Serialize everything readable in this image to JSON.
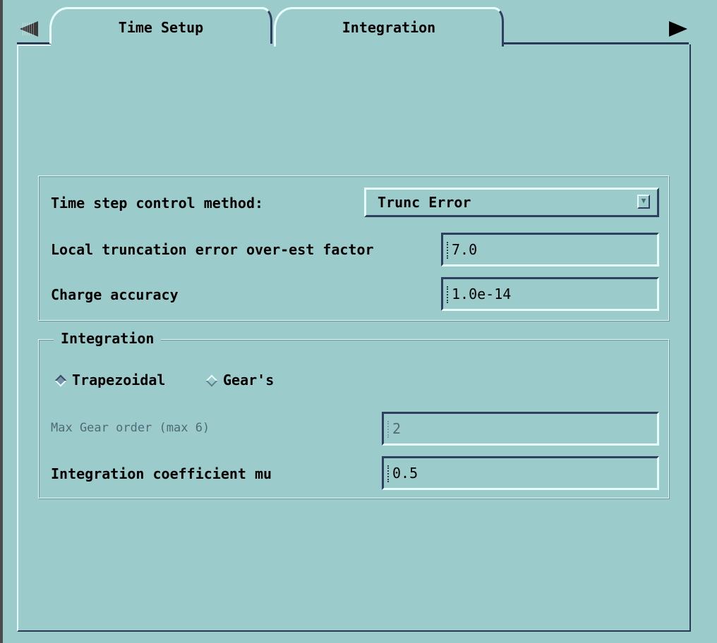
{
  "tabs": {
    "time_setup": "Time Setup",
    "integration": "Integration"
  },
  "timestep": {
    "method_label": "Time step control method:",
    "method_value": "Trunc Error",
    "lte_label": "Local truncation error over-est factor",
    "lte_value": "7.0",
    "charge_label": "Charge accuracy",
    "charge_value": "1.0e-14"
  },
  "integration": {
    "legend": "Integration",
    "options": [
      "Trapezoidal",
      "Gear's"
    ],
    "selected": "Trapezoidal",
    "max_gear_label": "Max Gear order (max 6)",
    "max_gear_value": "2",
    "mu_label": "Integration coefficient mu",
    "mu_value": "0.5"
  },
  "icons": {
    "scroll_left": "left-arrow-icon",
    "scroll_right": "right-arrow-icon",
    "dropdown": "chevron-down-icon"
  },
  "colors": {
    "background": "#9ccbcb",
    "highlight": "#e8ffff",
    "shadow": "#2f3f5f",
    "disabled_text": "#506a78"
  }
}
